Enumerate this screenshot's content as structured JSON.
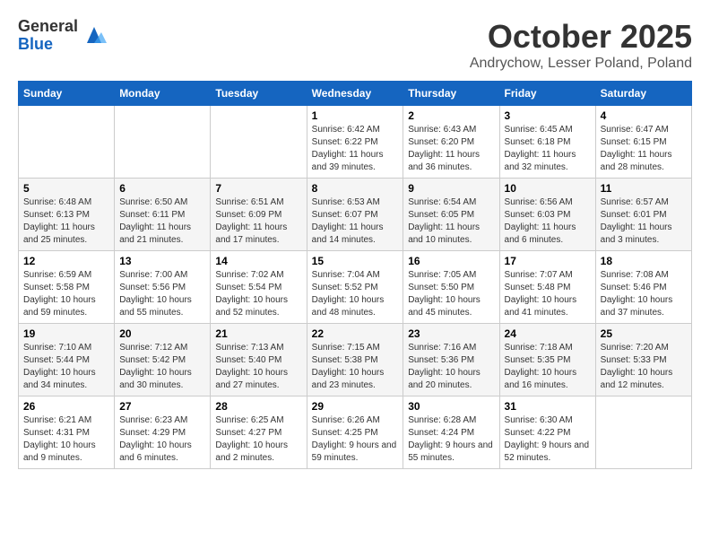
{
  "logo": {
    "general": "General",
    "blue": "Blue"
  },
  "title": "October 2025",
  "subtitle": "Andrychow, Lesser Poland, Poland",
  "days_of_week": [
    "Sunday",
    "Monday",
    "Tuesday",
    "Wednesday",
    "Thursday",
    "Friday",
    "Saturday"
  ],
  "weeks": [
    [
      {
        "day": "",
        "info": ""
      },
      {
        "day": "",
        "info": ""
      },
      {
        "day": "",
        "info": ""
      },
      {
        "day": "1",
        "info": "Sunrise: 6:42 AM\nSunset: 6:22 PM\nDaylight: 11 hours and 39 minutes."
      },
      {
        "day": "2",
        "info": "Sunrise: 6:43 AM\nSunset: 6:20 PM\nDaylight: 11 hours and 36 minutes."
      },
      {
        "day": "3",
        "info": "Sunrise: 6:45 AM\nSunset: 6:18 PM\nDaylight: 11 hours and 32 minutes."
      },
      {
        "day": "4",
        "info": "Sunrise: 6:47 AM\nSunset: 6:15 PM\nDaylight: 11 hours and 28 minutes."
      }
    ],
    [
      {
        "day": "5",
        "info": "Sunrise: 6:48 AM\nSunset: 6:13 PM\nDaylight: 11 hours and 25 minutes."
      },
      {
        "day": "6",
        "info": "Sunrise: 6:50 AM\nSunset: 6:11 PM\nDaylight: 11 hours and 21 minutes."
      },
      {
        "day": "7",
        "info": "Sunrise: 6:51 AM\nSunset: 6:09 PM\nDaylight: 11 hours and 17 minutes."
      },
      {
        "day": "8",
        "info": "Sunrise: 6:53 AM\nSunset: 6:07 PM\nDaylight: 11 hours and 14 minutes."
      },
      {
        "day": "9",
        "info": "Sunrise: 6:54 AM\nSunset: 6:05 PM\nDaylight: 11 hours and 10 minutes."
      },
      {
        "day": "10",
        "info": "Sunrise: 6:56 AM\nSunset: 6:03 PM\nDaylight: 11 hours and 6 minutes."
      },
      {
        "day": "11",
        "info": "Sunrise: 6:57 AM\nSunset: 6:01 PM\nDaylight: 11 hours and 3 minutes."
      }
    ],
    [
      {
        "day": "12",
        "info": "Sunrise: 6:59 AM\nSunset: 5:58 PM\nDaylight: 10 hours and 59 minutes."
      },
      {
        "day": "13",
        "info": "Sunrise: 7:00 AM\nSunset: 5:56 PM\nDaylight: 10 hours and 55 minutes."
      },
      {
        "day": "14",
        "info": "Sunrise: 7:02 AM\nSunset: 5:54 PM\nDaylight: 10 hours and 52 minutes."
      },
      {
        "day": "15",
        "info": "Sunrise: 7:04 AM\nSunset: 5:52 PM\nDaylight: 10 hours and 48 minutes."
      },
      {
        "day": "16",
        "info": "Sunrise: 7:05 AM\nSunset: 5:50 PM\nDaylight: 10 hours and 45 minutes."
      },
      {
        "day": "17",
        "info": "Sunrise: 7:07 AM\nSunset: 5:48 PM\nDaylight: 10 hours and 41 minutes."
      },
      {
        "day": "18",
        "info": "Sunrise: 7:08 AM\nSunset: 5:46 PM\nDaylight: 10 hours and 37 minutes."
      }
    ],
    [
      {
        "day": "19",
        "info": "Sunrise: 7:10 AM\nSunset: 5:44 PM\nDaylight: 10 hours and 34 minutes."
      },
      {
        "day": "20",
        "info": "Sunrise: 7:12 AM\nSunset: 5:42 PM\nDaylight: 10 hours and 30 minutes."
      },
      {
        "day": "21",
        "info": "Sunrise: 7:13 AM\nSunset: 5:40 PM\nDaylight: 10 hours and 27 minutes."
      },
      {
        "day": "22",
        "info": "Sunrise: 7:15 AM\nSunset: 5:38 PM\nDaylight: 10 hours and 23 minutes."
      },
      {
        "day": "23",
        "info": "Sunrise: 7:16 AM\nSunset: 5:36 PM\nDaylight: 10 hours and 20 minutes."
      },
      {
        "day": "24",
        "info": "Sunrise: 7:18 AM\nSunset: 5:35 PM\nDaylight: 10 hours and 16 minutes."
      },
      {
        "day": "25",
        "info": "Sunrise: 7:20 AM\nSunset: 5:33 PM\nDaylight: 10 hours and 12 minutes."
      }
    ],
    [
      {
        "day": "26",
        "info": "Sunrise: 6:21 AM\nSunset: 4:31 PM\nDaylight: 10 hours and 9 minutes."
      },
      {
        "day": "27",
        "info": "Sunrise: 6:23 AM\nSunset: 4:29 PM\nDaylight: 10 hours and 6 minutes."
      },
      {
        "day": "28",
        "info": "Sunrise: 6:25 AM\nSunset: 4:27 PM\nDaylight: 10 hours and 2 minutes."
      },
      {
        "day": "29",
        "info": "Sunrise: 6:26 AM\nSunset: 4:25 PM\nDaylight: 9 hours and 59 minutes."
      },
      {
        "day": "30",
        "info": "Sunrise: 6:28 AM\nSunset: 4:24 PM\nDaylight: 9 hours and 55 minutes."
      },
      {
        "day": "31",
        "info": "Sunrise: 6:30 AM\nSunset: 4:22 PM\nDaylight: 9 hours and 52 minutes."
      },
      {
        "day": "",
        "info": ""
      }
    ]
  ]
}
